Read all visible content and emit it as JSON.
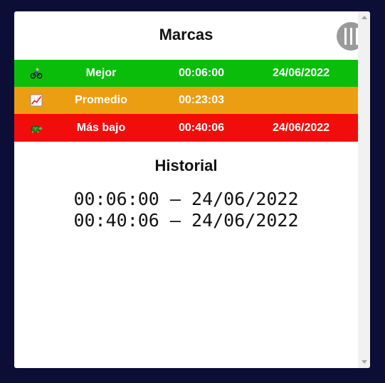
{
  "panel": {
    "title": "Marcas",
    "menu_button_icon": "hamburger-vertical-icon"
  },
  "records": [
    {
      "icon": "cyclist-icon",
      "label": "Mejor",
      "time": "00:06:00",
      "date": "24/06/2022",
      "color": "#0bbd0b"
    },
    {
      "icon": "chart-increasing-icon",
      "label": "Promedio",
      "time": "00:23:03",
      "date": "",
      "color": "#ec9e12"
    },
    {
      "icon": "turtle-icon",
      "label": "Más bajo",
      "time": "00:40:06",
      "date": "24/06/2022",
      "color": "#f20d0d"
    }
  ],
  "history": {
    "title": "Historial",
    "entries": [
      "00:06:00 – 24/06/2022",
      "00:40:06 – 24/06/2022"
    ]
  },
  "colors": {
    "background": "#0c0e36",
    "panel": "#ffffff",
    "menu_button": "#9a9a9a"
  }
}
